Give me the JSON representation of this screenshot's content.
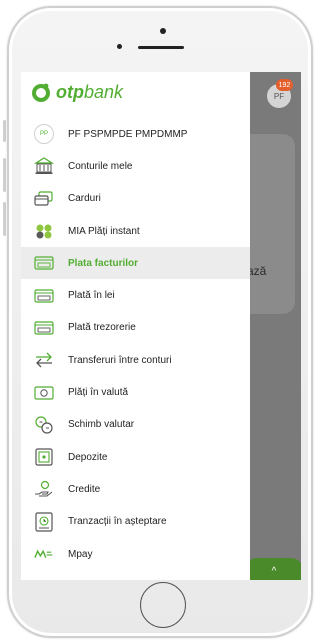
{
  "header": {
    "logo_text_otp": "otp",
    "logo_text_bank": "bank"
  },
  "background": {
    "avatar_initials": "PF",
    "notification_count": "192",
    "text_fragment": "ază",
    "green_button_icon": "^"
  },
  "menu": {
    "items": [
      {
        "label": "PF PSPMPDE PMPDMMP",
        "icon": "PP"
      },
      {
        "label": "Conturile mele",
        "icon": "bank-building-icon"
      },
      {
        "label": "Carduri",
        "icon": "cards-icon"
      },
      {
        "label": "MIA Plăți instant",
        "icon": "mia-icon"
      },
      {
        "label": "Plata facturilor",
        "icon": "bill-icon",
        "active": true
      },
      {
        "label": "Plată în lei",
        "icon": "payment-lei-icon"
      },
      {
        "label": "Plată trezorerie",
        "icon": "treasury-payment-icon"
      },
      {
        "label": "Transferuri între conturi",
        "icon": "transfer-arrows-icon"
      },
      {
        "label": "Plăți în valută",
        "icon": "currency-payment-icon"
      },
      {
        "label": "Schimb valutar",
        "icon": "currency-exchange-icon"
      },
      {
        "label": "Depozite",
        "icon": "deposit-icon"
      },
      {
        "label": "Credite",
        "icon": "credit-hand-icon"
      },
      {
        "label": "Tranzacții în așteptare",
        "icon": "pending-transactions-icon"
      },
      {
        "label": "Mpay",
        "icon": "mpay-logo-icon"
      }
    ]
  },
  "colors": {
    "accent": "#52ae32",
    "active_bg": "#ececec",
    "badge": "#e35f2c"
  }
}
